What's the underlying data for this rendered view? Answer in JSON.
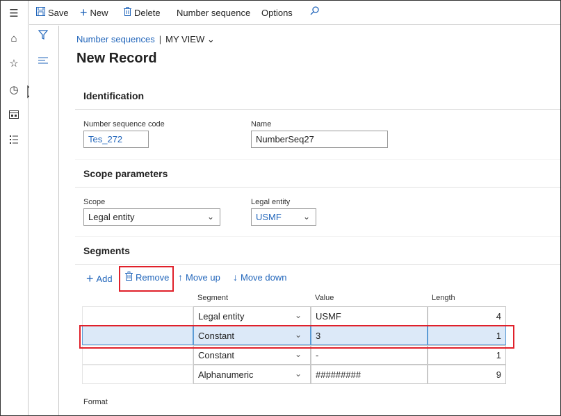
{
  "toolbar": {
    "save_label": "Save",
    "new_label": "New",
    "delete_label": "Delete",
    "number_sequence_label": "Number sequence",
    "options_label": "Options"
  },
  "breadcrumb": {
    "module": "Number sequences",
    "separator": "|",
    "view": "MY VIEW"
  },
  "page_title": "New Record",
  "identification": {
    "header": "Identification",
    "code_label": "Number sequence code",
    "code_value": "Tes_272",
    "name_label": "Name",
    "name_value": "NumberSeq27"
  },
  "scope": {
    "header": "Scope parameters",
    "scope_label": "Scope",
    "scope_value": "Legal entity",
    "legal_entity_label": "Legal entity",
    "legal_entity_value": "USMF"
  },
  "segments": {
    "header": "Segments",
    "add_label": "Add",
    "remove_label": "Remove",
    "move_up_label": "Move up",
    "move_down_label": "Move down",
    "columns": [
      "Segment",
      "Value",
      "Length"
    ],
    "rows": [
      {
        "segment": "Legal entity",
        "value": "USMF",
        "length": "4"
      },
      {
        "segment": "Constant",
        "value": "3",
        "length": "1"
      },
      {
        "segment": "Constant",
        "value": "-",
        "length": "1"
      },
      {
        "segment": "Alphanumeric",
        "value": "#########",
        "length": "9"
      }
    ],
    "selected_row": 1
  },
  "format_label": "Format",
  "colors": {
    "accent": "#2266bb",
    "highlight_box": "#e0202a",
    "selected_row": "#dce9f8"
  }
}
